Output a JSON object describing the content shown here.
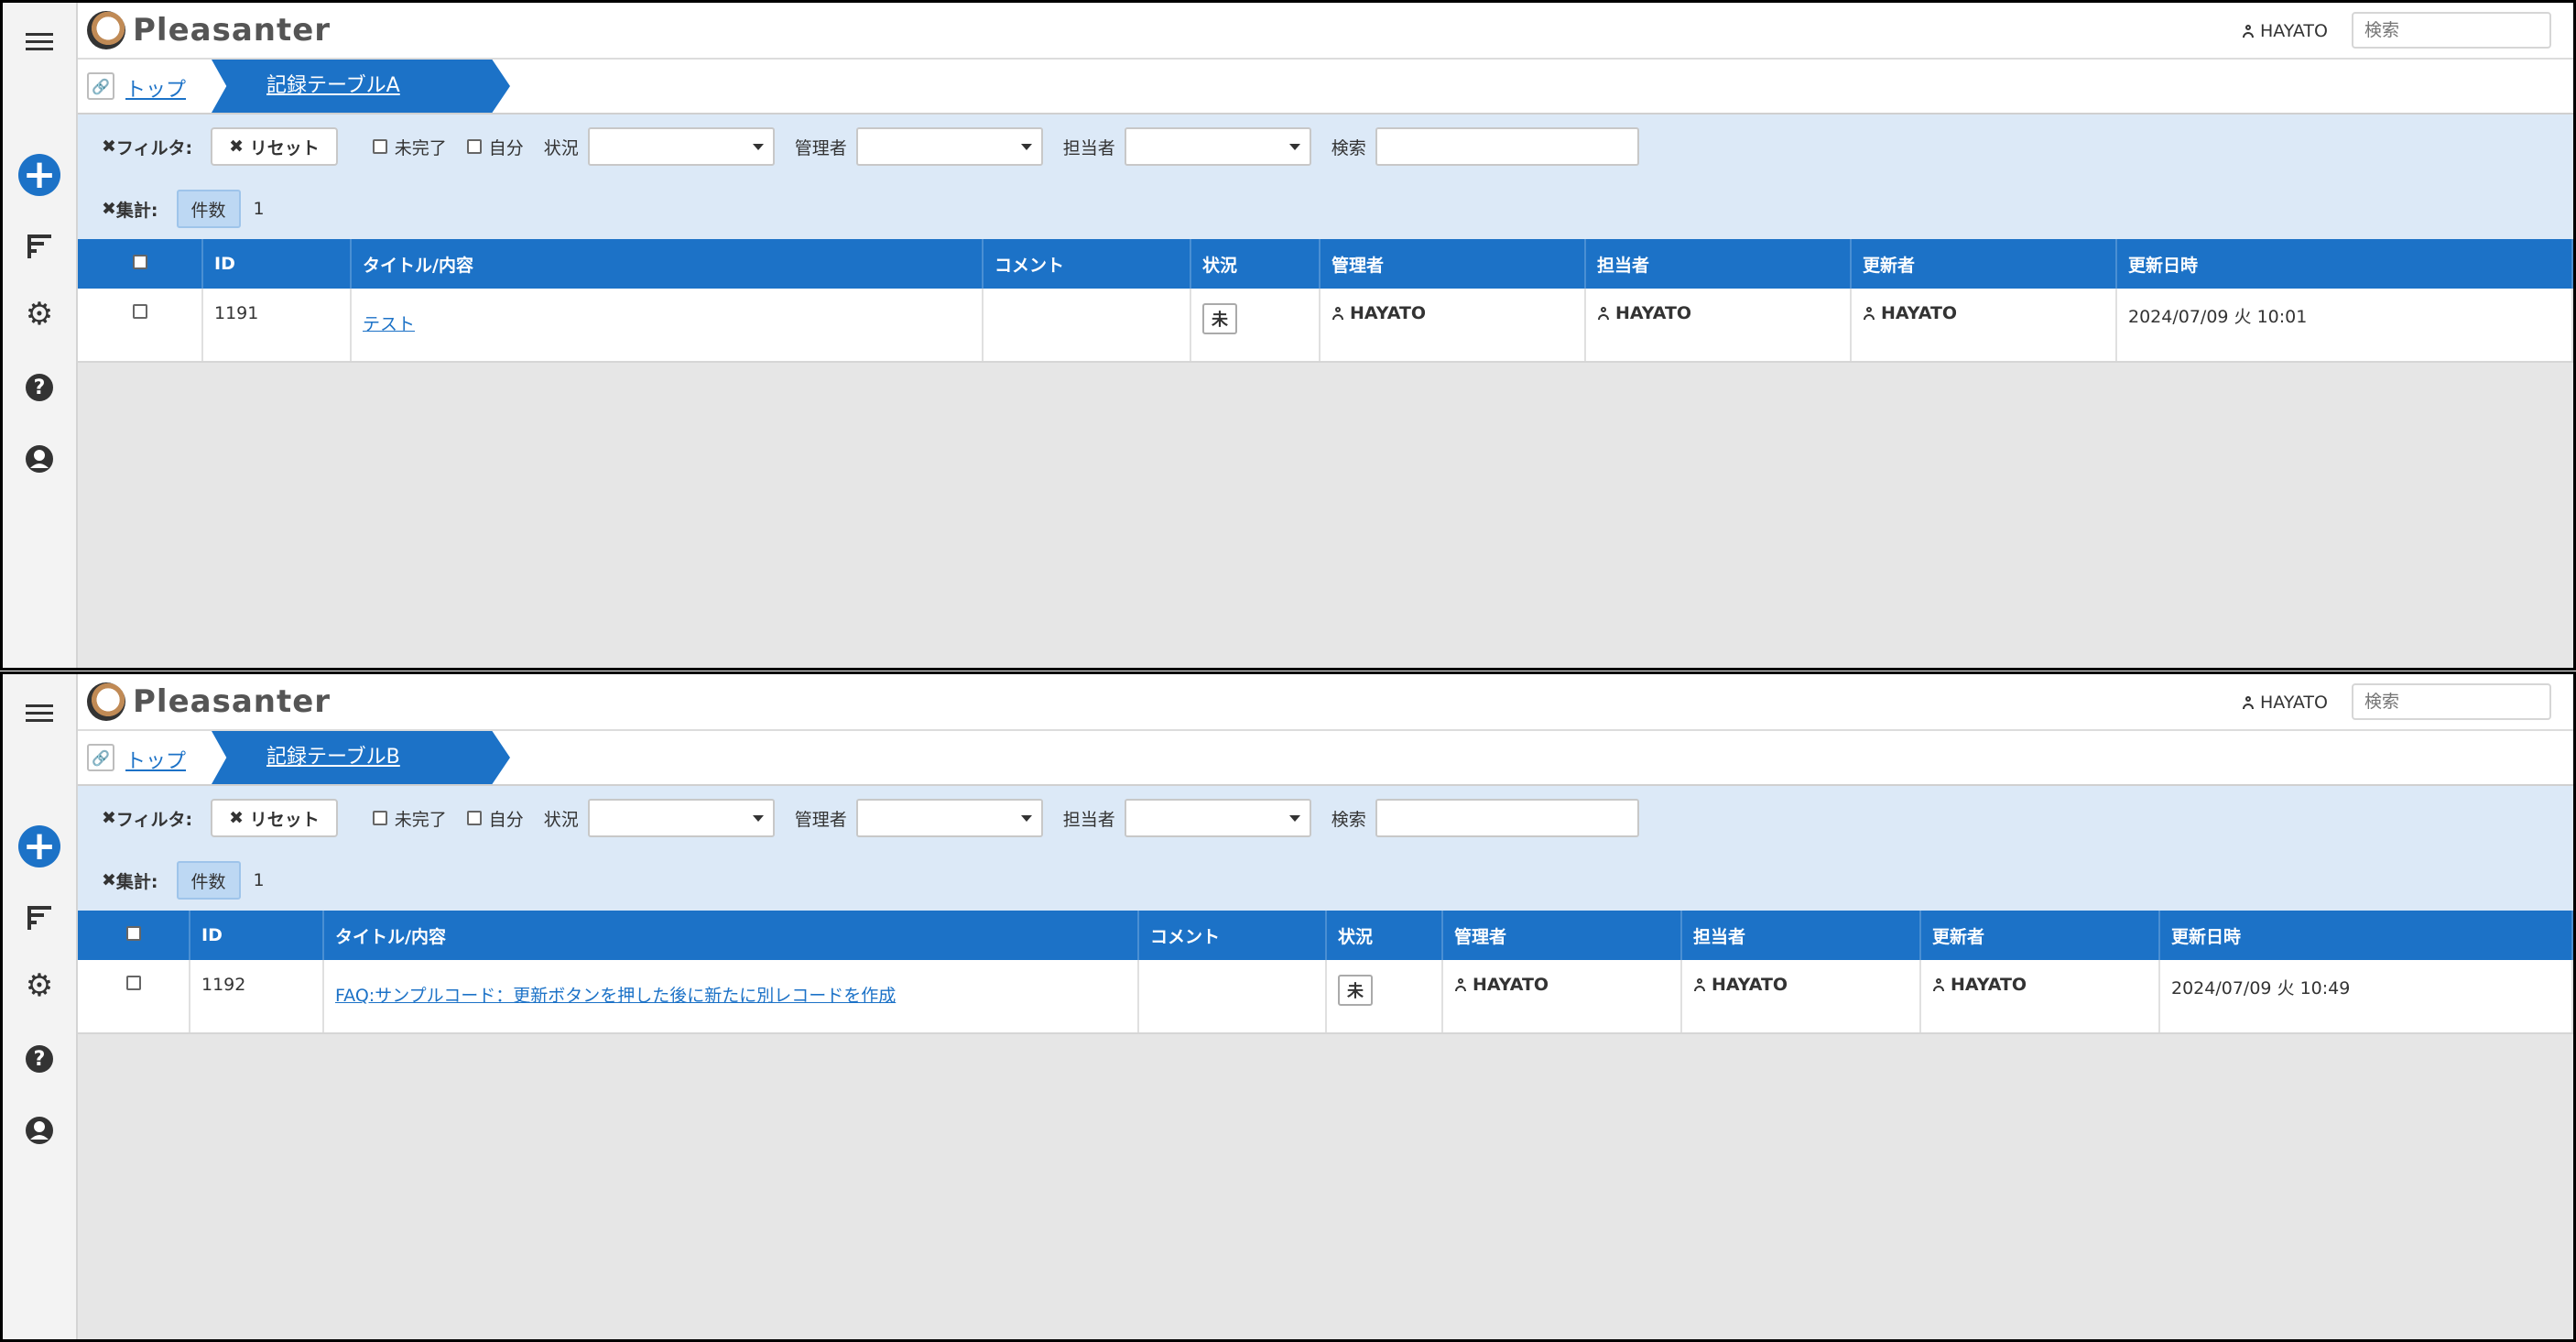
{
  "app": {
    "name": "Pleasanter"
  },
  "header": {
    "user": "HAYATO",
    "search_placeholder": "検索"
  },
  "breadcrumb": {
    "top": "トップ"
  },
  "filters": {
    "filter_label": "フィルタ:",
    "reset": "リセット",
    "incomplete": "未完了",
    "self": "自分",
    "status": "状況",
    "manager": "管理者",
    "owner": "担当者",
    "search": "検索"
  },
  "aggregate": {
    "label": "集計:",
    "count_label": "件数"
  },
  "columns": [
    "ID",
    "タイトル/内容",
    "コメント",
    "状況",
    "管理者",
    "担当者",
    "更新者",
    "更新日時"
  ],
  "panels": [
    {
      "table_name": "記録テーブルA",
      "count": "1",
      "row": {
        "id": "1191",
        "title": "テスト",
        "comment": "",
        "status": "未",
        "manager": "HAYATO",
        "owner": "HAYATO",
        "updater": "HAYATO",
        "updated": "2024/07/09 火 10:01"
      }
    },
    {
      "table_name": "記録テーブルB",
      "count": "1",
      "row": {
        "id": "1192",
        "title": "FAQ:サンプルコード：更新ボタンを押した後に新たに別レコードを作成",
        "comment": "",
        "status": "未",
        "manager": "HAYATO",
        "owner": "HAYATO",
        "updater": "HAYATO",
        "updated": "2024/07/09 火 10:49"
      }
    }
  ]
}
